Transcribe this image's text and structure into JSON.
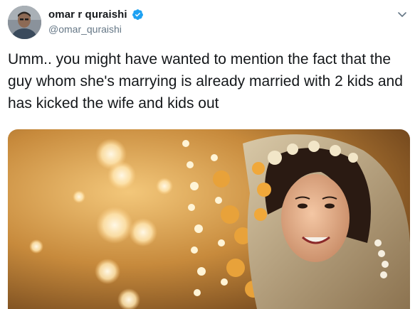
{
  "tweet": {
    "author": {
      "display_name": "omar r quraishi",
      "handle": "@omar_quraishi",
      "verified": true
    },
    "text": "Umm.. you might have wanted to mention the fact that the guy whom she's marrying is already married with 2 kids and has kicked the wife and kids out",
    "icons": {
      "verified": "verified-badge-icon",
      "menu": "chevron-down-icon"
    },
    "colors": {
      "verified_blue": "#1da1f2",
      "handle_gray": "#657786",
      "text": "#14171a"
    }
  }
}
